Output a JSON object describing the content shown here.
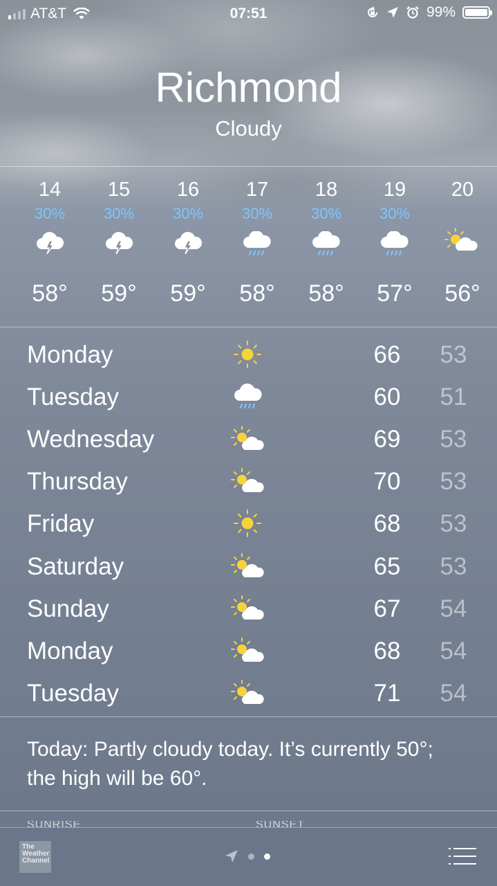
{
  "status_bar": {
    "carrier": "AT&T",
    "time": "07:51",
    "battery": "99%",
    "signal_bars_active": 1,
    "signal_bars_total": 4,
    "icons": [
      "signal-icon",
      "wifi-icon",
      "orientation-lock-icon",
      "location-arrow-icon",
      "alarm-icon",
      "battery-icon"
    ]
  },
  "header": {
    "city": "Richmond",
    "condition": "Cloudy"
  },
  "hourly": [
    {
      "hour": "14",
      "pop": "30%",
      "icon": "thunderstorm-icon",
      "temp": "58°"
    },
    {
      "hour": "15",
      "pop": "30%",
      "icon": "thunderstorm-icon",
      "temp": "59°"
    },
    {
      "hour": "16",
      "pop": "30%",
      "icon": "thunderstorm-icon",
      "temp": "59°"
    },
    {
      "hour": "17",
      "pop": "30%",
      "icon": "rain-icon",
      "temp": "58°"
    },
    {
      "hour": "18",
      "pop": "30%",
      "icon": "rain-icon",
      "temp": "58°"
    },
    {
      "hour": "19",
      "pop": "30%",
      "icon": "rain-icon",
      "temp": "57°"
    },
    {
      "hour": "20",
      "pop": "",
      "icon": "partly-cloudy-icon",
      "temp": "56°"
    }
  ],
  "daily": [
    {
      "day": "Monday",
      "icon": "sun-icon",
      "high": "66",
      "low": "53"
    },
    {
      "day": "Tuesday",
      "icon": "rain-icon",
      "high": "60",
      "low": "51"
    },
    {
      "day": "Wednesday",
      "icon": "partly-cloudy-icon",
      "high": "69",
      "low": "53"
    },
    {
      "day": "Thursday",
      "icon": "partly-cloudy-icon",
      "high": "70",
      "low": "53"
    },
    {
      "day": "Friday",
      "icon": "sun-icon",
      "high": "68",
      "low": "53"
    },
    {
      "day": "Saturday",
      "icon": "partly-cloudy-icon",
      "high": "65",
      "low": "53"
    },
    {
      "day": "Sunday",
      "icon": "partly-cloudy-icon",
      "high": "67",
      "low": "54"
    },
    {
      "day": "Monday",
      "icon": "partly-cloudy-icon",
      "high": "68",
      "low": "54"
    },
    {
      "day": "Tuesday",
      "icon": "partly-cloudy-icon",
      "high": "71",
      "low": "54"
    }
  ],
  "summary": "Today: Partly cloudy today. It’s currently 50°; the high will be 60°.",
  "details_peek": {
    "left": "SUNRISE",
    "right": "SUNSET"
  },
  "bottom_bar": {
    "logo_text": "The Weather Channel",
    "page_count": 2,
    "current_page": 2,
    "icons": [
      "location-arrow-icon",
      "list-icon"
    ]
  },
  "colors": {
    "precip_blue": "#7fc6ff",
    "sun_yellow": "#f6d33a",
    "low_temp": "rgba(255,255,255,0.5)"
  }
}
